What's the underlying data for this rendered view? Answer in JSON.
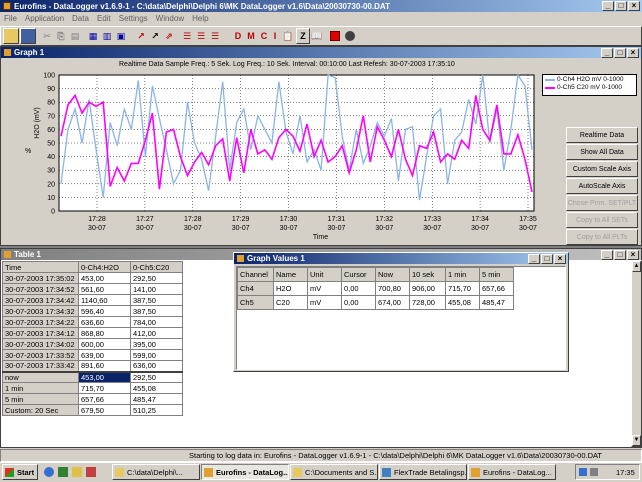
{
  "app": {
    "title": "Eurofins - DataLogger v1.6.9-1 - C:\\data\\Delphi\\Delphi 6\\MK DataLogger v1.6\\Data\\20030730-00.DAT"
  },
  "menu": [
    "File",
    "Application",
    "Data",
    "Edit",
    "Settings",
    "Window",
    "Help"
  ],
  "toolbar": {
    "labels": [
      "D",
      "M",
      "C",
      "I",
      "Z"
    ]
  },
  "graph_window": {
    "title": "Graph 1",
    "info_line": "Realtime Data   Sample Freq.: 5 Sek.   Log Freq.: 10 Sek.   Interval: 00:10:00   Last Refesh: 30-07-2003 17:35:10",
    "ylabel": "H2O (mV)",
    "ylabel_unit": "%",
    "xlabel": "Time",
    "buttons": [
      "Realtime Data",
      "Show All Data",
      "Custom Scale Axis",
      "AutoScale Axis",
      "Chose Prim. SET/PLT",
      "Copy to All SETs",
      "Copy to All PLTs"
    ],
    "buttons_disabled": [
      false,
      false,
      false,
      false,
      true,
      true,
      true
    ]
  },
  "chart_data": {
    "type": "line",
    "title": "",
    "xlabel": "Time",
    "ylabel": "H2O (mV)",
    "ylim": [
      0,
      100
    ],
    "yticks": [
      0,
      10,
      20,
      30,
      40,
      50,
      60,
      70,
      80,
      90,
      100
    ],
    "xtick_labels": [
      [
        "17:28",
        "30-07"
      ],
      [
        "17:27",
        "30-07"
      ],
      [
        "17:28",
        "30-07"
      ],
      [
        "17:29",
        "30-07"
      ],
      [
        "17:30",
        "30-07"
      ],
      [
        "17:31",
        "30-07"
      ],
      [
        "17:32",
        "30-07"
      ],
      [
        "17:33",
        "30-07"
      ],
      [
        "17:34",
        "30-07"
      ],
      [
        "17:35",
        "30-07"
      ]
    ],
    "grid": true,
    "legend_position": "top-right",
    "series": [
      {
        "name": "0-Ch4 H2O mV 0-1000",
        "color": "#8ab4e8",
        "values": [
          20,
          60,
          75,
          50,
          82,
          45,
          10,
          65,
          48,
          75,
          60,
          96,
          40,
          92,
          68,
          45,
          20,
          30,
          80,
          50,
          38,
          15,
          55,
          95,
          30,
          65,
          75,
          45,
          70,
          60,
          50,
          95,
          58,
          42,
          70,
          36,
          45,
          30,
          100,
          98,
          55,
          30,
          60,
          35,
          48,
          65,
          55,
          68,
          22,
          60,
          62,
          8,
          40,
          70,
          75,
          20,
          52,
          58,
          82,
          64,
          100,
          50,
          75,
          30,
          60,
          100,
          92,
          45
        ]
      },
      {
        "name": "0-Ch5 C20 mV 0-1000",
        "color": "#ff00ff",
        "values": [
          55,
          78,
          85,
          72,
          80,
          77,
          80,
          18,
          32,
          22,
          35,
          35,
          52,
          72,
          16,
          58,
          60,
          40,
          26,
          36,
          43,
          34,
          48,
          53,
          22,
          54,
          28,
          60,
          42,
          45,
          38,
          54,
          60,
          55,
          44,
          64,
          40,
          52,
          36,
          40,
          48,
          28,
          45,
          70,
          36,
          62,
          52,
          40,
          60,
          38,
          26,
          48,
          46,
          58,
          36,
          42,
          38,
          52,
          46,
          85,
          60,
          52,
          78,
          42,
          42,
          56,
          38,
          14
        ]
      }
    ]
  },
  "table_window": {
    "title": "Table 1",
    "headers": [
      "Time",
      "0-Ch4:H2O",
      "0-Ch5:C20"
    ],
    "rows": [
      [
        "30-07-2003 17:35:02",
        "453,00",
        "292,50"
      ],
      [
        "30-07-2003 17:34:52",
        "561,60",
        "141,00"
      ],
      [
        "30-07-2003 17:34:42",
        "1140,60",
        "387,50"
      ],
      [
        "30-07-2003 17:34:32",
        "596,40",
        "387,50"
      ],
      [
        "30-07-2003 17:34:22",
        "636,60",
        "784,00"
      ],
      [
        "30-07-2003 17:34:12",
        "868,80",
        "412,00"
      ],
      [
        "30-07-2003 17:34:02",
        "600,00",
        "395,00"
      ],
      [
        "30-07-2003 17:33:52",
        "639,00",
        "599,00"
      ],
      [
        "30-07-2003 17:33:42",
        "891,60",
        "636,00"
      ]
    ],
    "summary": [
      [
        "now",
        "453,00",
        "292,50"
      ],
      [
        "1 min",
        "715,70",
        "455,08"
      ],
      [
        "5 min",
        "657,66",
        "485,47"
      ],
      [
        "Custom: 20 Sec",
        "679,50",
        "510,25"
      ]
    ]
  },
  "graph_values": {
    "title": "Graph Values 1",
    "headers": [
      "Channel",
      "Name",
      "Unit",
      "Cursor",
      "Now",
      "10 sek",
      "1 min",
      "5 min"
    ],
    "rows": [
      [
        "Ch4",
        "H2O",
        "mV",
        "0,00",
        "700,80",
        "906,00",
        "715,70",
        "657,66"
      ],
      [
        "Ch5",
        "C20",
        "mV",
        "0,00",
        "674,00",
        "728,00",
        "455,08",
        "485,47"
      ]
    ]
  },
  "status": {
    "text": "Starting to log data in: Eurofins - DataLogger v1.6.9-1 - C:\\data\\Delphi\\Delphi 6\\MK DataLogger v1.6\\Data\\20030730-00.DAT"
  },
  "taskbar": {
    "start": "Start",
    "items": [
      "C:\\data\\Delphi\\...",
      "Eurofins - DataLog...",
      "C:\\Documents and S...",
      "FlexTrade Betalingsp...",
      "Eurofins - DataLog..."
    ],
    "clock": "17:35"
  }
}
